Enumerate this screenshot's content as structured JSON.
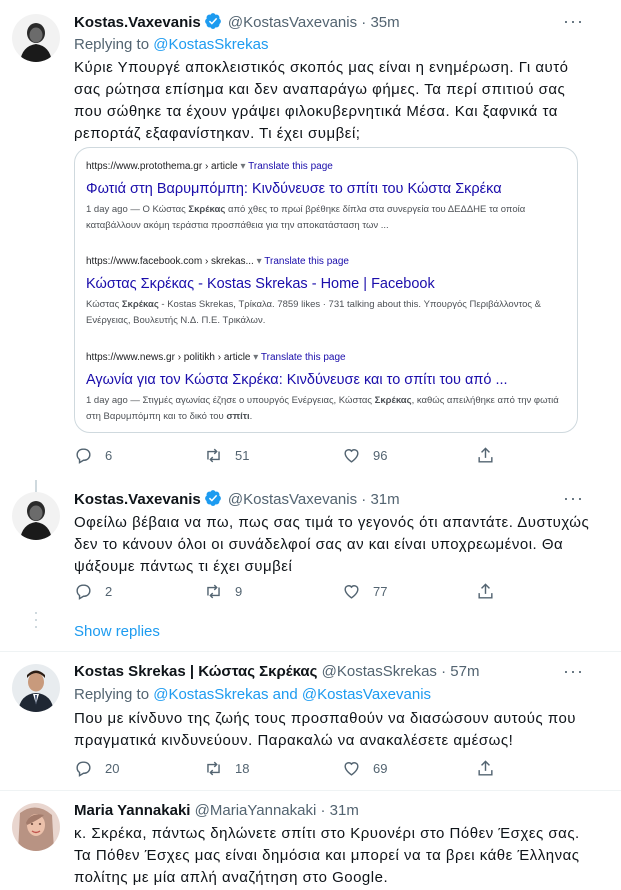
{
  "tweets": [
    {
      "name": "Kostas.Vaxevanis",
      "handle": "@KostasVaxevanis",
      "time": "35m",
      "replying_prefix": "Replying to ",
      "replying_to": "@KostasSkrekas",
      "body": "Κύριε Υπουργέ αποκλειστικός σκοπός μας είναι η ενημέρωση. Γι αυτό σας ρώτησα επίσημα και δεν αναπαράγω φήμες. Τα περί σπιτιού σας που σώθηκε τα έχουν γράψει φιλοκυβερνητικά Μέσα. Και ξαφνικά τα ρεπορτάζ εξαφανίστηκαν. Τι έχει συμβεί;",
      "replies": "6",
      "retweets": "51",
      "likes": "96"
    },
    {
      "name": "Kostas.Vaxevanis",
      "handle": "@KostasVaxevanis",
      "time": "31m",
      "body": "Οφείλω βέβαια να πω, πως σας τιμά το γεγονός ότι απαντάτε. Δυστυχώς δεν το κάνουν όλοι οι συνάδελφοί σας αν και είναι υποχρεωμένοι. Θα ψάξουμε πάντως τι έχει συμβεί",
      "replies": "2",
      "retweets": "9",
      "likes": "77"
    },
    {
      "name": "Kostas Skrekas | Κώστας Σκρέκας",
      "handle": "@KostasSkrekas",
      "time": "57m",
      "replying_prefix": "Replying to ",
      "replying_to": "@KostasSkrekas and @KostasVaxevanis",
      "body": "Που με κίνδυνο της ζωής τους προσπαθούν να διασώσουν αυτούς που πραγματικά κινδυνεύουν. Παρακαλώ να ανακαλέσετε αμέσως!",
      "replies": "20",
      "retweets": "18",
      "likes": "69"
    },
    {
      "name": "Maria Yannakaki",
      "handle": "@MariaYannakaki",
      "time": "31m",
      "body": "κ. Σκρέκα, πάντως δηλώνετε σπίτι στο Κρυονέρι στο Πόθεν Έσχες σας. Τα Πόθεν Έσχες μας είναι δημόσια και μπορεί να τα βρει κάθε Έλληνας πολίτης με μία απλή αναζήτηση στο Google."
    }
  ],
  "dot_sep": "·",
  "show_replies": "Show replies",
  "search_results": [
    {
      "url": "https://www.protothema.gr › article",
      "translate": "Translate this page",
      "title": "Φωτιά στη Βαρυμπόμπη: Κινδύνευσε το σπίτι του Κώστα Σκρέκα",
      "snippet_a": "1 day ago — Ο Κώστας ",
      "snippet_b": "Σκρέκας",
      "snippet_c": " από χθες το πρωί βρέθηκε δίπλα στα συνεργεία του ΔΕΔΔΗΕ τα οποία καταβάλλουν ακόμη τεράστια προσπάθεια για την αποκατάσταση των ..."
    },
    {
      "url": "https://www.facebook.com › skrekas...",
      "translate": "Translate this page",
      "title": "Κώστας Σκρέκας - Kostas Skrekas - Home | Facebook",
      "snippet_a": "Κώστας ",
      "snippet_b": "Σκρέκας",
      "snippet_c": " - Kostas Skrekas, Τρίκαλα. 7859 likes · 731 talking about this. Υπουργός Περιβάλλοντος & Ενέργειας, Βουλευτής Ν.Δ. Π.Ε. Τρικάλων."
    },
    {
      "url": "https://www.news.gr › politikh › article",
      "translate": "Translate this page",
      "title": "Αγωνία για τον Κώστα Σκρέκα: Κινδύνευσε και το σπίτι του από ...",
      "snippet_a": "1 day ago — Στιγμές αγωνίας έζησε ο υπουργός Ενέργειας, Κώστας ",
      "snippet_b": "Σκρέκας",
      "snippet_c": ", καθώς απειλήθηκε από την φωτιά στη Βαρυμπόμπη και το δικό του ",
      "snippet_d": "σπίτι",
      "snippet_e": "."
    }
  ],
  "colors": {
    "accent": "#1d9bf0",
    "text": "#0f1419",
    "secondary": "#536471",
    "link": "#1a0dab",
    "border": "#cfd9de"
  }
}
